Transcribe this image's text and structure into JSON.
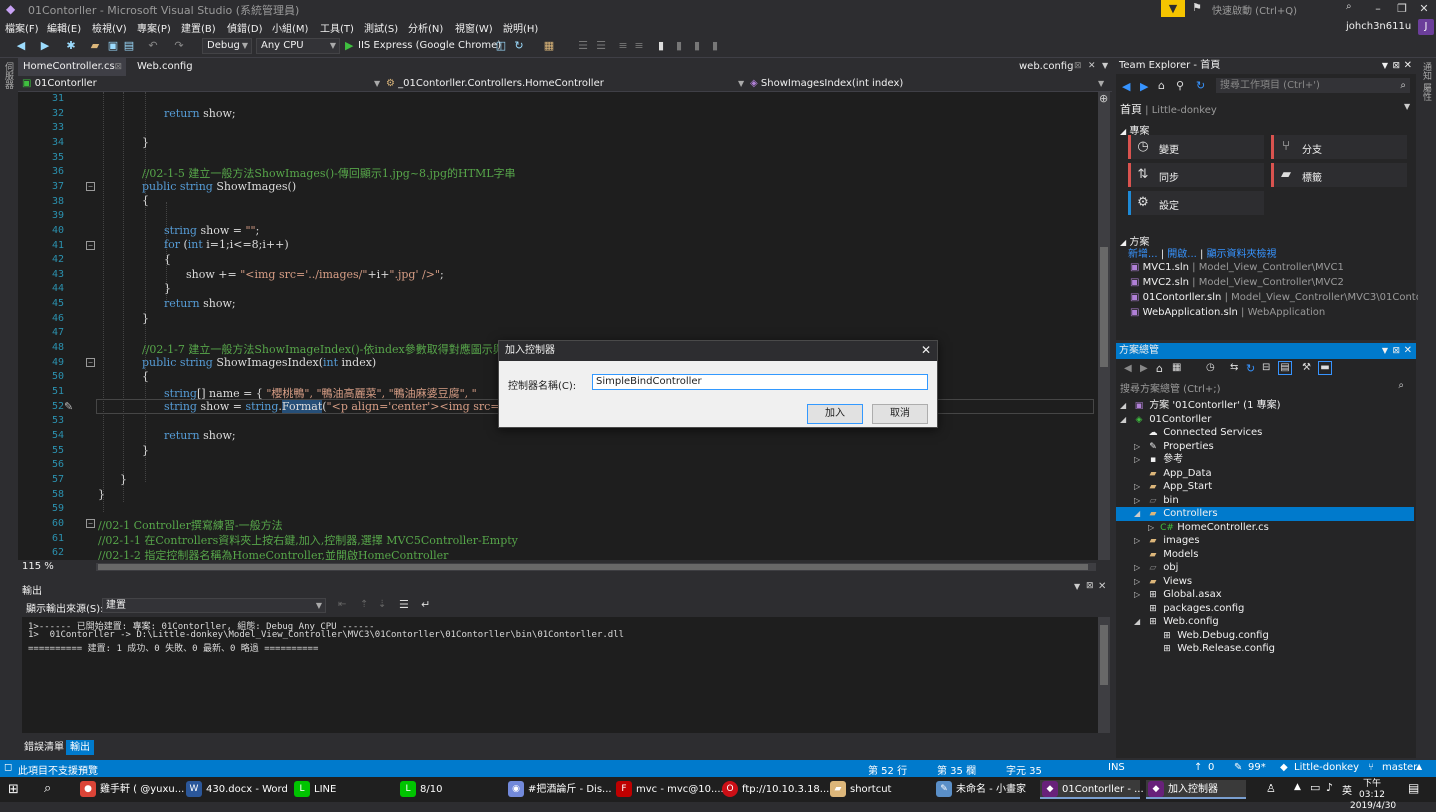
{
  "window": {
    "title": "01Contorller - Microsoft Visual Studio (系統管理員)",
    "quick_launch": "快速啟動 (Ctrl+Q)"
  },
  "menu": [
    "檔案(F)",
    "編輯(E)",
    "檢視(V)",
    "專案(P)",
    "建置(B)",
    "偵錯(D)",
    "小組(M)",
    "工具(T)",
    "測試(S)",
    "分析(N)",
    "視窗(W)",
    "說明(H)"
  ],
  "user": {
    "name": "johch3n611u",
    "initial": "J"
  },
  "toolbar": {
    "config": "Debug",
    "platform": "Any CPU",
    "run_target": "IIS Express (Google Chrome)"
  },
  "tabs": {
    "active": "HomeController.cs",
    "second": "Web.config",
    "right": "web.config"
  },
  "navbar": {
    "project": "01Contorller",
    "class": "_01Contorller.Controllers.HomeController",
    "member": "ShowImagesIndex(int index)"
  },
  "code": {
    "lines": [
      "31",
      "32",
      "33",
      "34",
      "35",
      "36",
      "37",
      "38",
      "39",
      "40",
      "41",
      "42",
      "43",
      "44",
      "45",
      "46",
      "47",
      "48",
      "49",
      "50",
      "51",
      "52",
      "53",
      "54",
      "55",
      "56",
      "57",
      "58",
      "59",
      "60",
      "61",
      "62"
    ],
    "l33_kw": "return",
    "l33_tx": " show;",
    "l35_brace": "}",
    "l37_comment": "//02-1-5 建立一般方法ShowImages()-傳回顯示1.jpg~8.jpg的HTML字串",
    "l38_kw": "public string",
    "l38_tx": " ShowImages()",
    "l39_brace": "{",
    "l41_kw": "string",
    "l41_tx": " show = ",
    "l41_st": "\"\"",
    "l41_end": ";",
    "l42_kw": "for",
    "l42_tx": " (",
    "l42_kw2": "int",
    "l42_tx2": " i=1;i<=8;i++)",
    "l43_brace": "{",
    "l44_tx": "show += ",
    "l44_st": "\"<img src='../images/\"",
    "l44_tx2": "+i+",
    "l44_st2": "\".jpg' />\"",
    "l44_end": ";",
    "l45_brace": "}",
    "l46_kw": "return",
    "l46_tx": " show;",
    "l47_brace": "}",
    "l49_comment": "//02-1-7 建立一般方法ShowImageIndex()-依index參數取得對應圖示與",
    "l50_kw": "public string",
    "l50_tx": " ShowImagesIndex(",
    "l50_kw2": "int",
    "l50_tx2": " index)",
    "l51_brace": "{",
    "l52_kw": "string",
    "l52_tx": "[] name = { ",
    "l52_st": "\"櫻桃鴨\", \"鴨油高麗菜\", \"鴨油麻婆豆腐\", \"",
    "l53_kw": "string",
    "l53_tx": " show = ",
    "l53_kw2": "string",
    "l53_tx2": ".",
    "l53_fn": "Format",
    "l53_tx3": "(",
    "l53_st": "\"<p align='center'><img src='...",
    "l55_kw": "return",
    "l55_tx": " show;",
    "l56_brace": "}",
    "l58_brace": "}",
    "l59_brace": "}",
    "l61_comment": "//02-1 Controller撰寫練習-一般方法",
    "l62_comment": "//02-1-1 在Controllers資料夾上按右鍵,加入,控制器,選擇 MVC5Controller-Empty",
    "l63_comment": "//02-1-2 指定控制器名稱為HomeController,並開啟HomeController"
  },
  "zoom": "115 %",
  "output": {
    "title": "輸出",
    "source_label": "顯示輸出來源(S):",
    "source_value": "建置",
    "lines": [
      "1>------ 已開始建置: 專案: 01Contorller, 組態: Debug Any CPU ------",
      "1>  01Contorller -> D:\\Little-donkey\\Model_View_Controller\\MVC3\\01Contorller\\01Contorller\\bin\\01Contorller.dll",
      "========== 建置: 1 成功、0 失敗、0 最新、0 略過 =========="
    ]
  },
  "bottom_tabs": [
    "錯誤清單",
    "輸出"
  ],
  "team_explorer": {
    "title": "Team Explorer - 首頁",
    "search_placeholder": "搜尋工作項目 (Ctrl+')",
    "home": "首頁",
    "repo": "Little-donkey",
    "project_section": "專案",
    "tiles": [
      "變更",
      "分支",
      "同步",
      "標籤",
      "設定"
    ],
    "solution_section": "方案",
    "links": [
      "新增...",
      "開啟...",
      "顯示資料夾檢視"
    ],
    "solutions": [
      {
        "name": "MVC1.sln",
        "path": "Model_View_Controller\\MVC1"
      },
      {
        "name": "MVC2.sln",
        "path": "Model_View_Controller\\MVC2"
      },
      {
        "name": "01Contorller.sln",
        "path": "Model_View_Controller\\MVC3\\01Contor..."
      },
      {
        "name": "WebApplication.sln",
        "path": "WebApplication"
      }
    ]
  },
  "solution_explorer": {
    "title": "方案總管",
    "search_placeholder": "搜尋方案總管 (Ctrl+;)",
    "nodes": [
      "方案 '01Contorller' (1 專案)",
      "01Contorller",
      "Connected Services",
      "Properties",
      "參考",
      "App_Data",
      "App_Start",
      "bin",
      "Controllers",
      "HomeController.cs",
      "images",
      "Models",
      "obj",
      "Views",
      "Global.asax",
      "packages.config",
      "Web.config",
      "Web.Debug.config",
      "Web.Release.config"
    ]
  },
  "dialog": {
    "title": "加入控制器",
    "label": "控制器名稱(C):",
    "value": "SimpleBindController",
    "add": "加入",
    "cancel": "取消"
  },
  "status": {
    "left": "此項目不支援預覽",
    "line": "第 52 行",
    "col": "第 35 欄",
    "ch": "字元 35",
    "ins": "INS",
    "up": "0",
    "pencil": "99*",
    "repo": "Little-donkey",
    "branch": "master"
  },
  "taskbar": {
    "items": [
      "雞手軒 ( @yuxu...",
      "430.docx - Word",
      "LINE",
      "8/10",
      "#把酒論斤 - Dis...",
      "mvc - mvc@10....",
      "ftp://10.10.3.18...",
      "shortcut",
      "未命名 - 小畫家",
      "01Contorller - ...",
      "加入控制器"
    ],
    "time": "下午 03:12",
    "date": "2019/4/30",
    "ime": "英"
  }
}
